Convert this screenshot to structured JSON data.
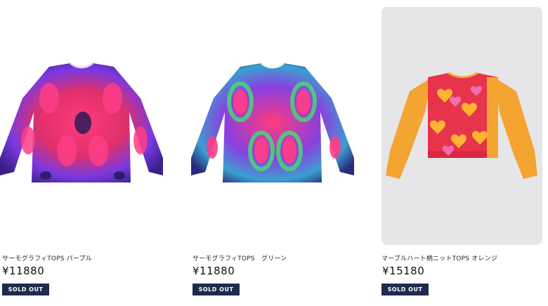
{
  "products": [
    {
      "name": "サーモグラフィTOPS パープル",
      "price": "¥11880",
      "badge": "SOLD OUT"
    },
    {
      "name": "サーモグラフィTOPS　グリーン",
      "price": "¥11880",
      "badge": "SOLD OUT"
    },
    {
      "name": "マーブルハート柄ニットTOPS オレンジ",
      "price": "¥15180",
      "badge": "SOLD OUT"
    }
  ],
  "colors": {
    "badge_bg": "#1f2b4d",
    "purple_top": "#6a3fd8",
    "green_top": "#4bd07a",
    "orange_sleeve": "#f3a431",
    "heart_body": "#e8344a"
  }
}
